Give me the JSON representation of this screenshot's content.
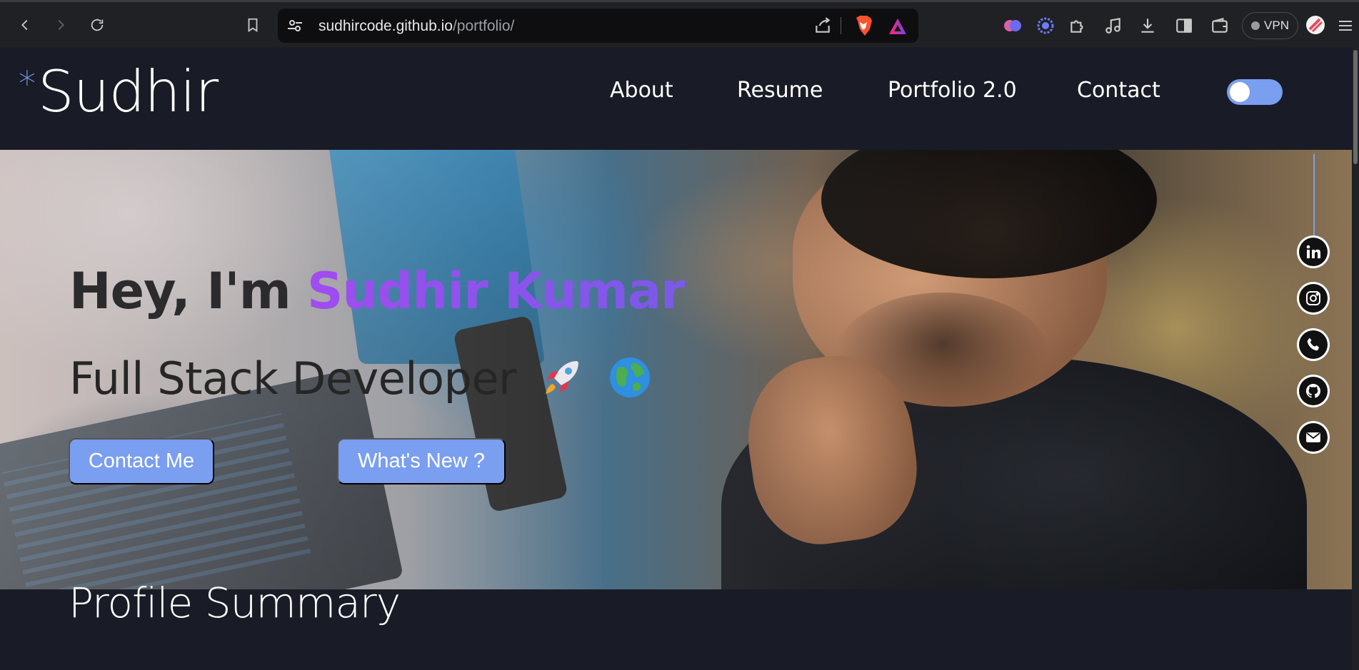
{
  "browser": {
    "url_host": "sudhircode.github.io",
    "url_path": "/portfolio/",
    "vpn_label": "VPN",
    "icons": [
      "back-icon",
      "forward-icon",
      "reload-icon",
      "bookmark-icon",
      "site-settings-icon",
      "share-icon",
      "brave-shields-icon",
      "brave-rewards-icon",
      "extension-brain-icon",
      "extension-puzzle-star-icon",
      "extensions-icon",
      "media-icon",
      "downloads-icon",
      "sidebar-icon",
      "wallet-icon",
      "profile-icon",
      "menu-icon"
    ]
  },
  "site": {
    "logo_star": "*",
    "logo_text": "Sudhir",
    "menu": [
      "About",
      "Resume",
      "Portfolio 2.0",
      "Contact"
    ],
    "theme_toggle": "off"
  },
  "hero": {
    "greeting": "Hey, I'm ",
    "name": "Sudhir Kumar",
    "subtitle": "Full Stack Developer",
    "emoji": [
      "rocket-icon",
      "globe-icon"
    ],
    "buttons": [
      "Contact Me",
      "What's New ?"
    ]
  },
  "social": [
    "linkedin-icon",
    "instagram-icon",
    "phone-icon",
    "github-icon",
    "mail-icon"
  ],
  "summary": {
    "title": "Profile Summary"
  },
  "colors": {
    "accent": "#7a9ef0",
    "page_bg": "#191c26",
    "name_gradient_start": "#a04cf0",
    "name_gradient_end": "#7a5ae8"
  }
}
